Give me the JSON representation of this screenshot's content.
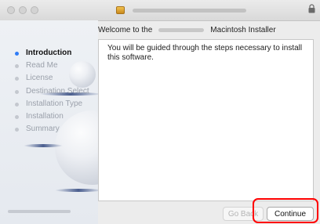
{
  "window": {
    "traffic_lights": [
      "close",
      "minimize",
      "zoom"
    ],
    "title_icon": "package-icon",
    "lock_icon": "lock-icon"
  },
  "heading": {
    "prefix": "Welcome to the",
    "suffix": "Macintosh Installer"
  },
  "sidebar": {
    "steps": [
      {
        "label": "Introduction",
        "active": true
      },
      {
        "label": "Read Me",
        "active": false
      },
      {
        "label": "License",
        "active": false
      },
      {
        "label": "Destination Select",
        "active": false
      },
      {
        "label": "Installation Type",
        "active": false
      },
      {
        "label": "Installation",
        "active": false
      },
      {
        "label": "Summary",
        "active": false
      }
    ]
  },
  "content": {
    "body": "You will be guided through the steps necessary to install this software."
  },
  "buttons": {
    "back_label": "Go Back",
    "continue_label": "Continue"
  },
  "colors": {
    "active_dot": "#2f7cf6",
    "highlight": "#ff0000"
  }
}
